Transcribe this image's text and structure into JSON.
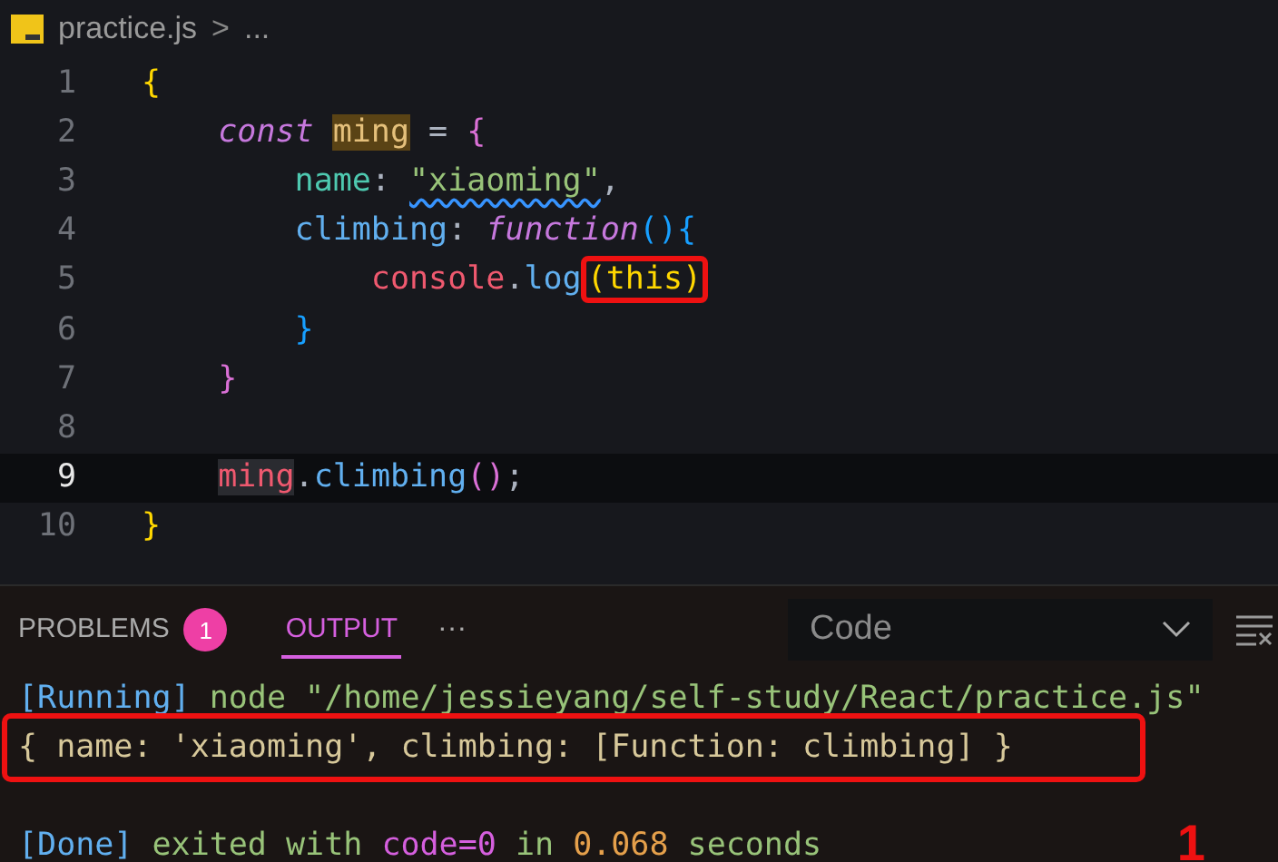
{
  "breadcrumb": {
    "file": "practice.js",
    "separator": ">",
    "rest": "..."
  },
  "code_lines": [
    {
      "number": "1",
      "active": false,
      "tokens": [
        {
          "text": "{",
          "kind": "bracket1"
        }
      ]
    },
    {
      "number": "2",
      "active": false,
      "tokens": [
        {
          "text": "    const ",
          "kind": "keyword"
        },
        {
          "text": "ming",
          "kind": "decl",
          "match": true
        },
        {
          "text": " = ",
          "kind": "plain"
        },
        {
          "text": "{",
          "kind": "bracket2"
        }
      ]
    },
    {
      "number": "3",
      "active": false,
      "tokens": [
        {
          "text": "        name",
          "kind": "prop"
        },
        {
          "text": ": ",
          "kind": "plain"
        },
        {
          "text": "\"xiaoming\"",
          "kind": "string",
          "warning": true
        },
        {
          "text": ",",
          "kind": "plain"
        }
      ]
    },
    {
      "number": "4",
      "active": false,
      "tokens": [
        {
          "text": "        climbing",
          "kind": "method"
        },
        {
          "text": ": ",
          "kind": "plain"
        },
        {
          "text": "function",
          "kind": "keyword"
        },
        {
          "text": "()",
          "kind": "bracket3"
        },
        {
          "text": "{",
          "kind": "bracket3"
        }
      ]
    },
    {
      "number": "5",
      "active": false,
      "tokens": [
        {
          "text": "            console",
          "kind": "var"
        },
        {
          "text": ".",
          "kind": "plain"
        },
        {
          "text": "log",
          "kind": "method"
        },
        {
          "text": "(this)",
          "kind": "bracket1",
          "highlighted": true
        }
      ]
    },
    {
      "number": "6",
      "active": false,
      "tokens": [
        {
          "text": "        }",
          "kind": "bracket3"
        }
      ]
    },
    {
      "number": "7",
      "active": false,
      "tokens": [
        {
          "text": "    }",
          "kind": "bracket2"
        }
      ]
    },
    {
      "number": "8",
      "active": false
    },
    {
      "number": "9",
      "active": true,
      "tokens": [
        {
          "text": "    ming",
          "kind": "var",
          "match": true
        },
        {
          "text": ".",
          "kind": "plain"
        },
        {
          "text": "climbing",
          "kind": "method"
        },
        {
          "text": "()",
          "kind": "bracket2"
        },
        {
          "text": ";",
          "kind": "plain"
        }
      ]
    },
    {
      "number": "10",
      "active": false,
      "tokens": [
        {
          "text": "}",
          "kind": "bracket1"
        }
      ]
    }
  ],
  "panel": {
    "tabs": [
      {
        "label": "PROBLEMS",
        "badge": "1",
        "selected": false
      },
      {
        "label": "OUTPUT",
        "selected": true
      }
    ],
    "more": "···",
    "channel_select": "Code"
  },
  "output_lines": [
    {
      "highlighted": false,
      "tokens": [
        {
          "text": "[Running]",
          "kind": "tag"
        },
        {
          "text": " node \"/home/jessieyang/self-study/React/practice.js\"",
          "kind": "ok"
        }
      ]
    },
    {
      "highlighted": true,
      "tokens": [
        {
          "text": "{ name: 'xiaoming', climbing: [Function: climbing] }",
          "kind": "plain"
        }
      ]
    },
    {
      "highlighted": false,
      "tokens": [
        {
          "text": "[Done]",
          "kind": "tag"
        },
        {
          "text": " exited with ",
          "kind": "ok"
        },
        {
          "text": "code=0",
          "kind": "code"
        },
        {
          "text": " in ",
          "kind": "ok"
        },
        {
          "text": "0.068",
          "kind": "num"
        },
        {
          "text": " seconds",
          "kind": "ok"
        }
      ]
    }
  ],
  "annotation": "1"
}
